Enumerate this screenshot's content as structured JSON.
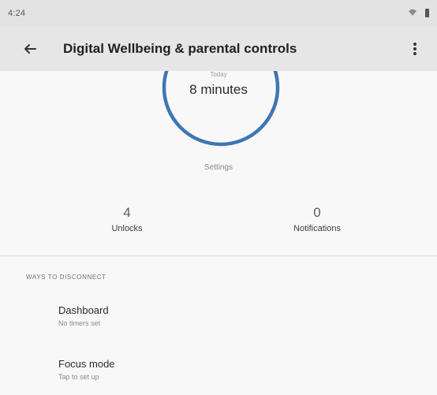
{
  "status_bar": {
    "time": "4:24",
    "icons": [
      "wifi-icon",
      "battery-icon"
    ]
  },
  "app_bar": {
    "title": "Digital Wellbeing & parental controls",
    "back_icon": "arrow-left-icon",
    "menu_icon": "more-vertical-icon"
  },
  "usage": {
    "caption": "Today",
    "total": "8 minutes",
    "settings_label": "Settings",
    "ring_color": "#3f76b3"
  },
  "stats": {
    "unlocks": {
      "value": "4",
      "label": "Unlocks"
    },
    "notifications": {
      "value": "0",
      "label": "Notifications"
    }
  },
  "ways_to_disconnect": {
    "header": "WAYS TO DISCONNECT",
    "items": [
      {
        "title": "Dashboard",
        "subtitle": "No timers set"
      },
      {
        "title": "Focus mode",
        "subtitle": "Tap to set up"
      }
    ]
  }
}
